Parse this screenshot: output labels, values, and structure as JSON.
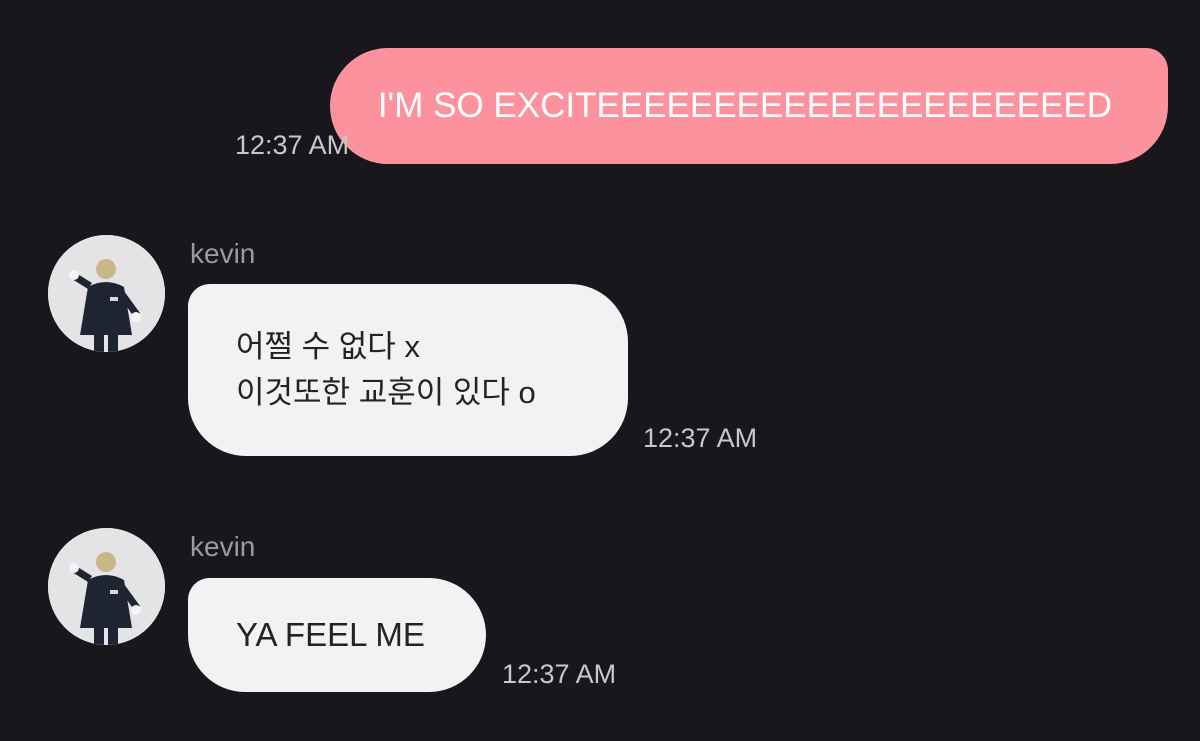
{
  "conversation": {
    "outgoing": [
      {
        "text": "I'M SO EXCITEEEEEEEEEEEEEEEEEEEEED",
        "time": "12:37 AM"
      }
    ],
    "incoming": [
      {
        "sender": "kevin",
        "lines": [
          "어쩔 수 없다 x",
          "이것또한 교훈이 있다 o"
        ],
        "time": "12:37 AM"
      },
      {
        "sender": "kevin",
        "lines": [
          "YA FEEL ME"
        ],
        "time": "12:37 AM"
      }
    ]
  },
  "colors": {
    "background": "#18181c",
    "outgoing_bubble": "#fc929e",
    "incoming_bubble": "#f2f2f5",
    "timestamp": "#c7c7cc",
    "sender_name": "#9a9aa0"
  },
  "icons": {
    "avatar": "profile-photo"
  }
}
